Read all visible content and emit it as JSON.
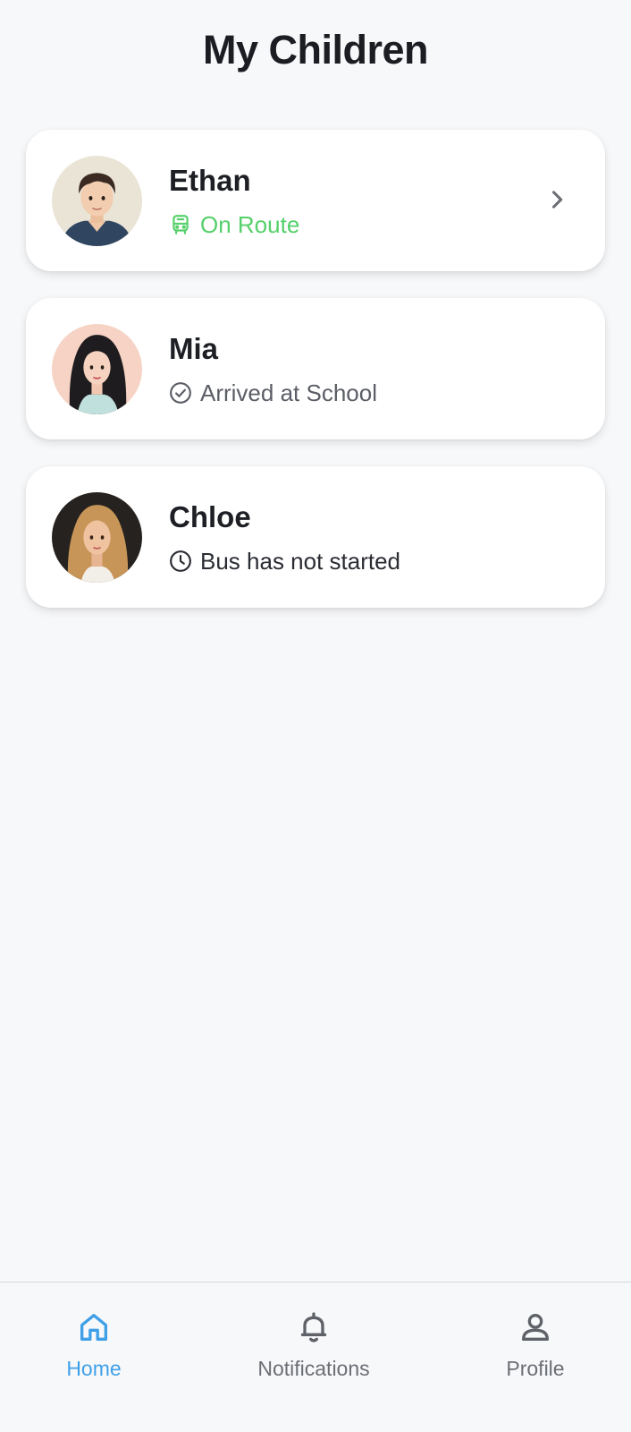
{
  "header": {
    "title": "My Children"
  },
  "children": [
    {
      "name": "Ethan",
      "status": "On Route",
      "status_icon": "bus-icon",
      "status_color": "#55d06a"
    },
    {
      "name": "Mia",
      "status": "Arrived at School",
      "status_icon": "check-circle-icon",
      "status_color": "#5b5e66"
    },
    {
      "name": "Chloe",
      "status": "Bus has not started",
      "status_icon": "clock-icon",
      "status_color": "#2a2c33"
    }
  ],
  "bottom_nav": {
    "items": [
      {
        "label": "Home",
        "icon": "home-icon",
        "active": true
      },
      {
        "label": "Notifications",
        "icon": "bell-icon",
        "active": false
      },
      {
        "label": "Profile",
        "icon": "person-icon",
        "active": false
      }
    ]
  },
  "colors": {
    "accent": "#3fa0e8",
    "on_route": "#55d06a",
    "background": "#f7f8fa"
  }
}
